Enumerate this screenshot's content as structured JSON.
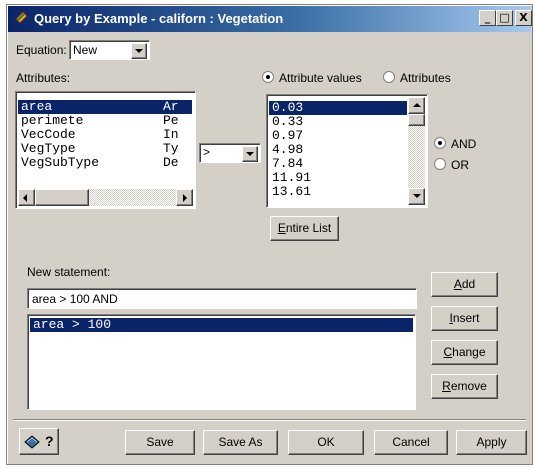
{
  "window": {
    "title": "Query by Example - californ : Vegetation",
    "title_controls": [
      "_",
      "□",
      "X"
    ]
  },
  "equation": {
    "label": "Equation:",
    "value": "New"
  },
  "attributes": {
    "label": "Attributes:",
    "rows": [
      {
        "name": "area",
        "type": "Ar"
      },
      {
        "name": "perimete",
        "type": "Pe"
      },
      {
        "name": "VecCode",
        "type": "In"
      },
      {
        "name": "VegType",
        "type": "Ty"
      },
      {
        "name": "VegSubType",
        "type": "De"
      }
    ],
    "selected_index": 0
  },
  "operator": {
    "value": ">"
  },
  "mode": {
    "attribute_values_label": "Attribute values",
    "attributes_label": "Attributes",
    "selected": "Attribute values"
  },
  "values": {
    "rows": [
      "0.03",
      "0.33",
      "0.97",
      "4.98",
      "7.84",
      "11.91",
      "13.61"
    ],
    "selected_index": 0
  },
  "connector": {
    "and_label": "AND",
    "or_label": "OR",
    "selected": "AND"
  },
  "entire_list": {
    "prefix": "E",
    "rest": "ntire List"
  },
  "statement": {
    "label": "New statement:",
    "value": "area > 100 AND"
  },
  "expressions": [
    "area > 100"
  ],
  "side_buttons": {
    "add": {
      "prefix": "A",
      "rest": "dd"
    },
    "insert": {
      "prefix": "I",
      "rest": "nsert"
    },
    "change": {
      "prefix": "C",
      "rest": "hange"
    },
    "remove": {
      "prefix": "R",
      "rest": "emove"
    }
  },
  "bottom_buttons": {
    "save": "Save",
    "save_as": "Save As",
    "ok": "OK",
    "cancel": "Cancel",
    "apply": "Apply",
    "help_glyph": "?"
  },
  "colors": {
    "face": "#d4d0c8",
    "selection": "#0a246a",
    "title_start": "#0a246a",
    "title_end": "#a6caf0"
  }
}
